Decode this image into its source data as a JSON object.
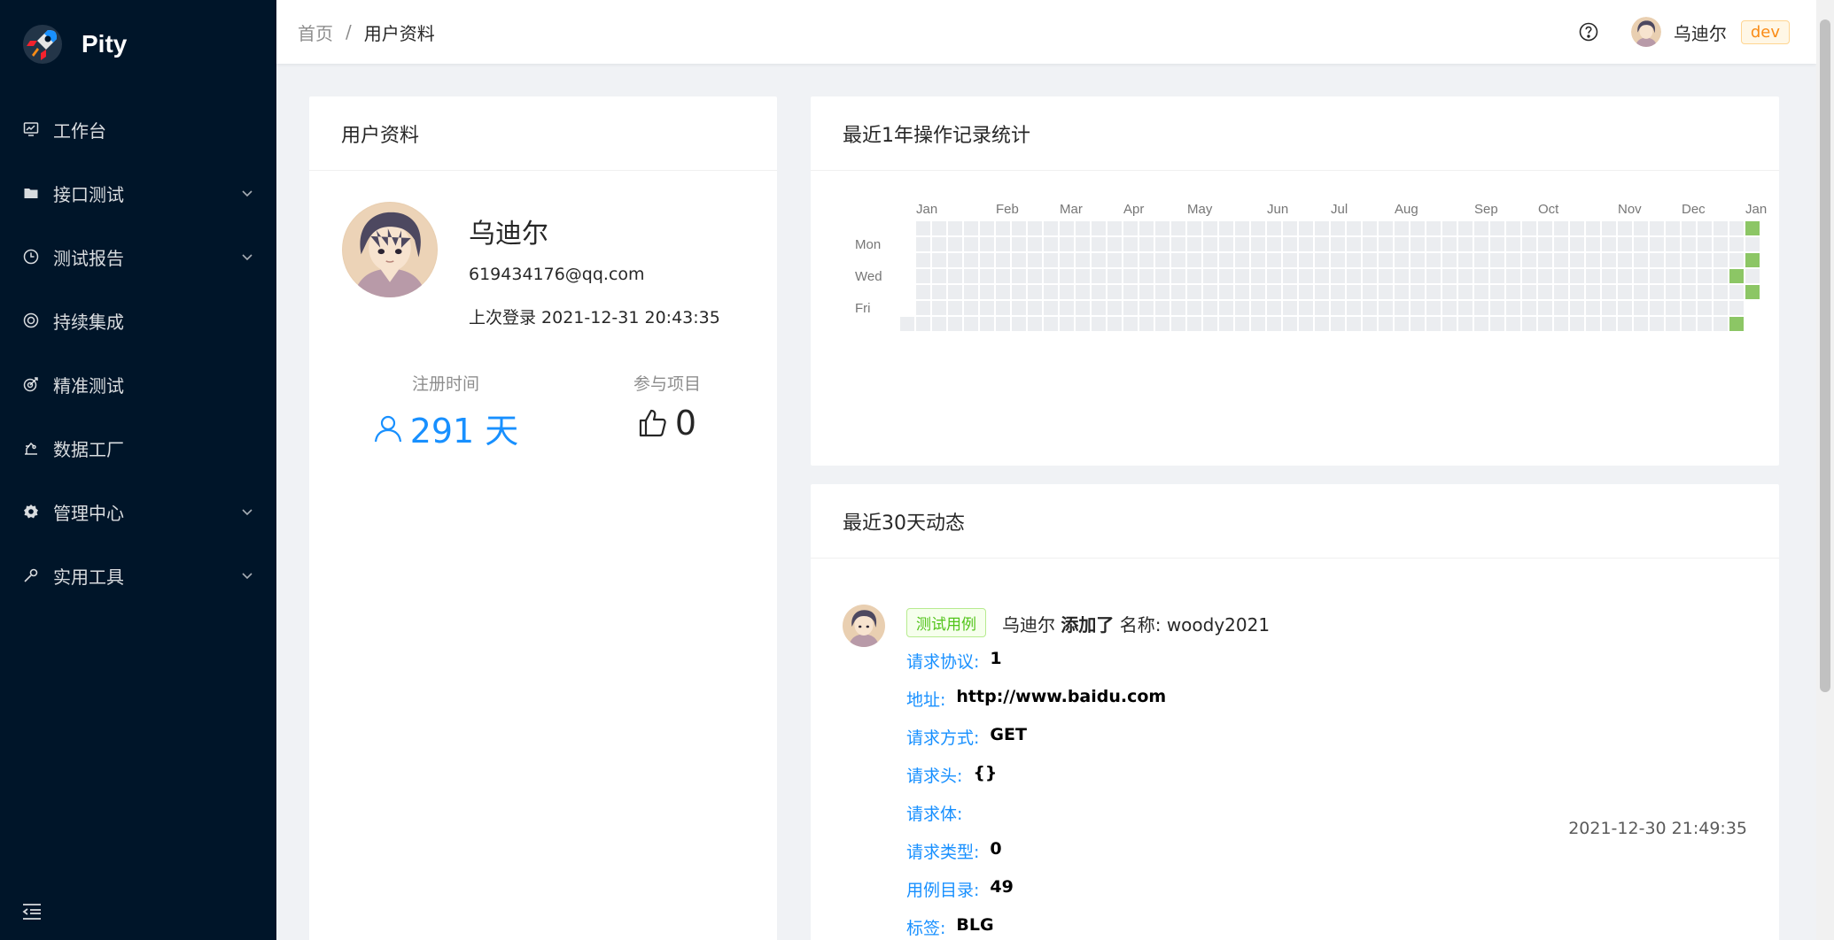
{
  "app": {
    "name": "Pity"
  },
  "sidebar": {
    "items": [
      {
        "label": "工作台",
        "icon": "dashboard-icon",
        "expandable": false
      },
      {
        "label": "接口测试",
        "icon": "folder-icon",
        "expandable": true
      },
      {
        "label": "测试报告",
        "icon": "clock-icon",
        "expandable": true
      },
      {
        "label": "持续集成",
        "icon": "target-icon",
        "expandable": false
      },
      {
        "label": "精准测试",
        "icon": "aim-icon",
        "expandable": false
      },
      {
        "label": "数据工厂",
        "icon": "factory-icon",
        "expandable": false
      },
      {
        "label": "管理中心",
        "icon": "gear-icon",
        "expandable": true
      },
      {
        "label": "实用工具",
        "icon": "wrench-icon",
        "expandable": true
      }
    ]
  },
  "header": {
    "breadcrumb": {
      "home": "首页",
      "separator": "/",
      "current": "用户资料"
    },
    "user_name": "乌迪尔",
    "env": "dev"
  },
  "profile": {
    "card_title": "用户资料",
    "name": "乌迪尔",
    "email": "619434176@qq.com",
    "last_login": "上次登录 2021-12-31 20:43:35",
    "stats": {
      "registered_title": "注册时间",
      "registered_value": "291 天",
      "projects_title": "参与项目",
      "projects_value": "0"
    }
  },
  "heatmap": {
    "title": "最近1年操作记录统计",
    "months": [
      "Jan",
      "Feb",
      "Mar",
      "Apr",
      "May",
      "Jun",
      "Jul",
      "Aug",
      "Sep",
      "Oct",
      "Nov",
      "Dec",
      "Jan"
    ],
    "days": [
      "Mon",
      "Wed",
      "Fri"
    ],
    "empty_color": "#ebedf0",
    "active_color": "#8cc665"
  },
  "feed": {
    "title": "最近30天动态",
    "tag": "测试用例",
    "user": "乌迪尔",
    "action": "添加了",
    "target": "名称: woody2021",
    "fields": [
      {
        "label": "请求协议:",
        "value": "1"
      },
      {
        "label": "地址:",
        "value": "http://www.baidu.com"
      },
      {
        "label": "请求方式:",
        "value": "GET"
      },
      {
        "label": "请求头:",
        "value": "{}"
      },
      {
        "label": "请求体:",
        "value": ""
      },
      {
        "label": "请求类型:",
        "value": "0"
      },
      {
        "label": "用例目录:",
        "value": "49"
      },
      {
        "label": "标签:",
        "value": "BLG"
      }
    ],
    "time": "2021-12-30 21:49:35"
  }
}
